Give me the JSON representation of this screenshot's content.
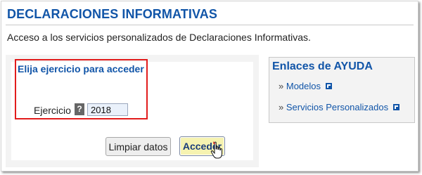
{
  "page": {
    "title": "DECLARACIONES INFORMATIVAS",
    "intro": "Acceso a los servicios personalizados de Declaraciones Informativas."
  },
  "form": {
    "heading": "Elija ejercicio para acceder",
    "year_label": "Ejercicio",
    "help_icon_text": "?",
    "year_value": "2018",
    "clear_button": "Limpiar datos",
    "submit_button": "Acceder"
  },
  "help": {
    "title": "Enlaces de AYUDA",
    "bullet": "»",
    "links": [
      {
        "label": "Modelos",
        "icon": "external-link-icon"
      },
      {
        "label": "Servicios Personalizados",
        "icon": "external-link-icon"
      }
    ]
  },
  "colors": {
    "heading_blue": "#1155a8",
    "highlight_red": "#e21c1c",
    "submit_bg": "#f6f3b1",
    "panel_gray": "#f3f3f3"
  }
}
